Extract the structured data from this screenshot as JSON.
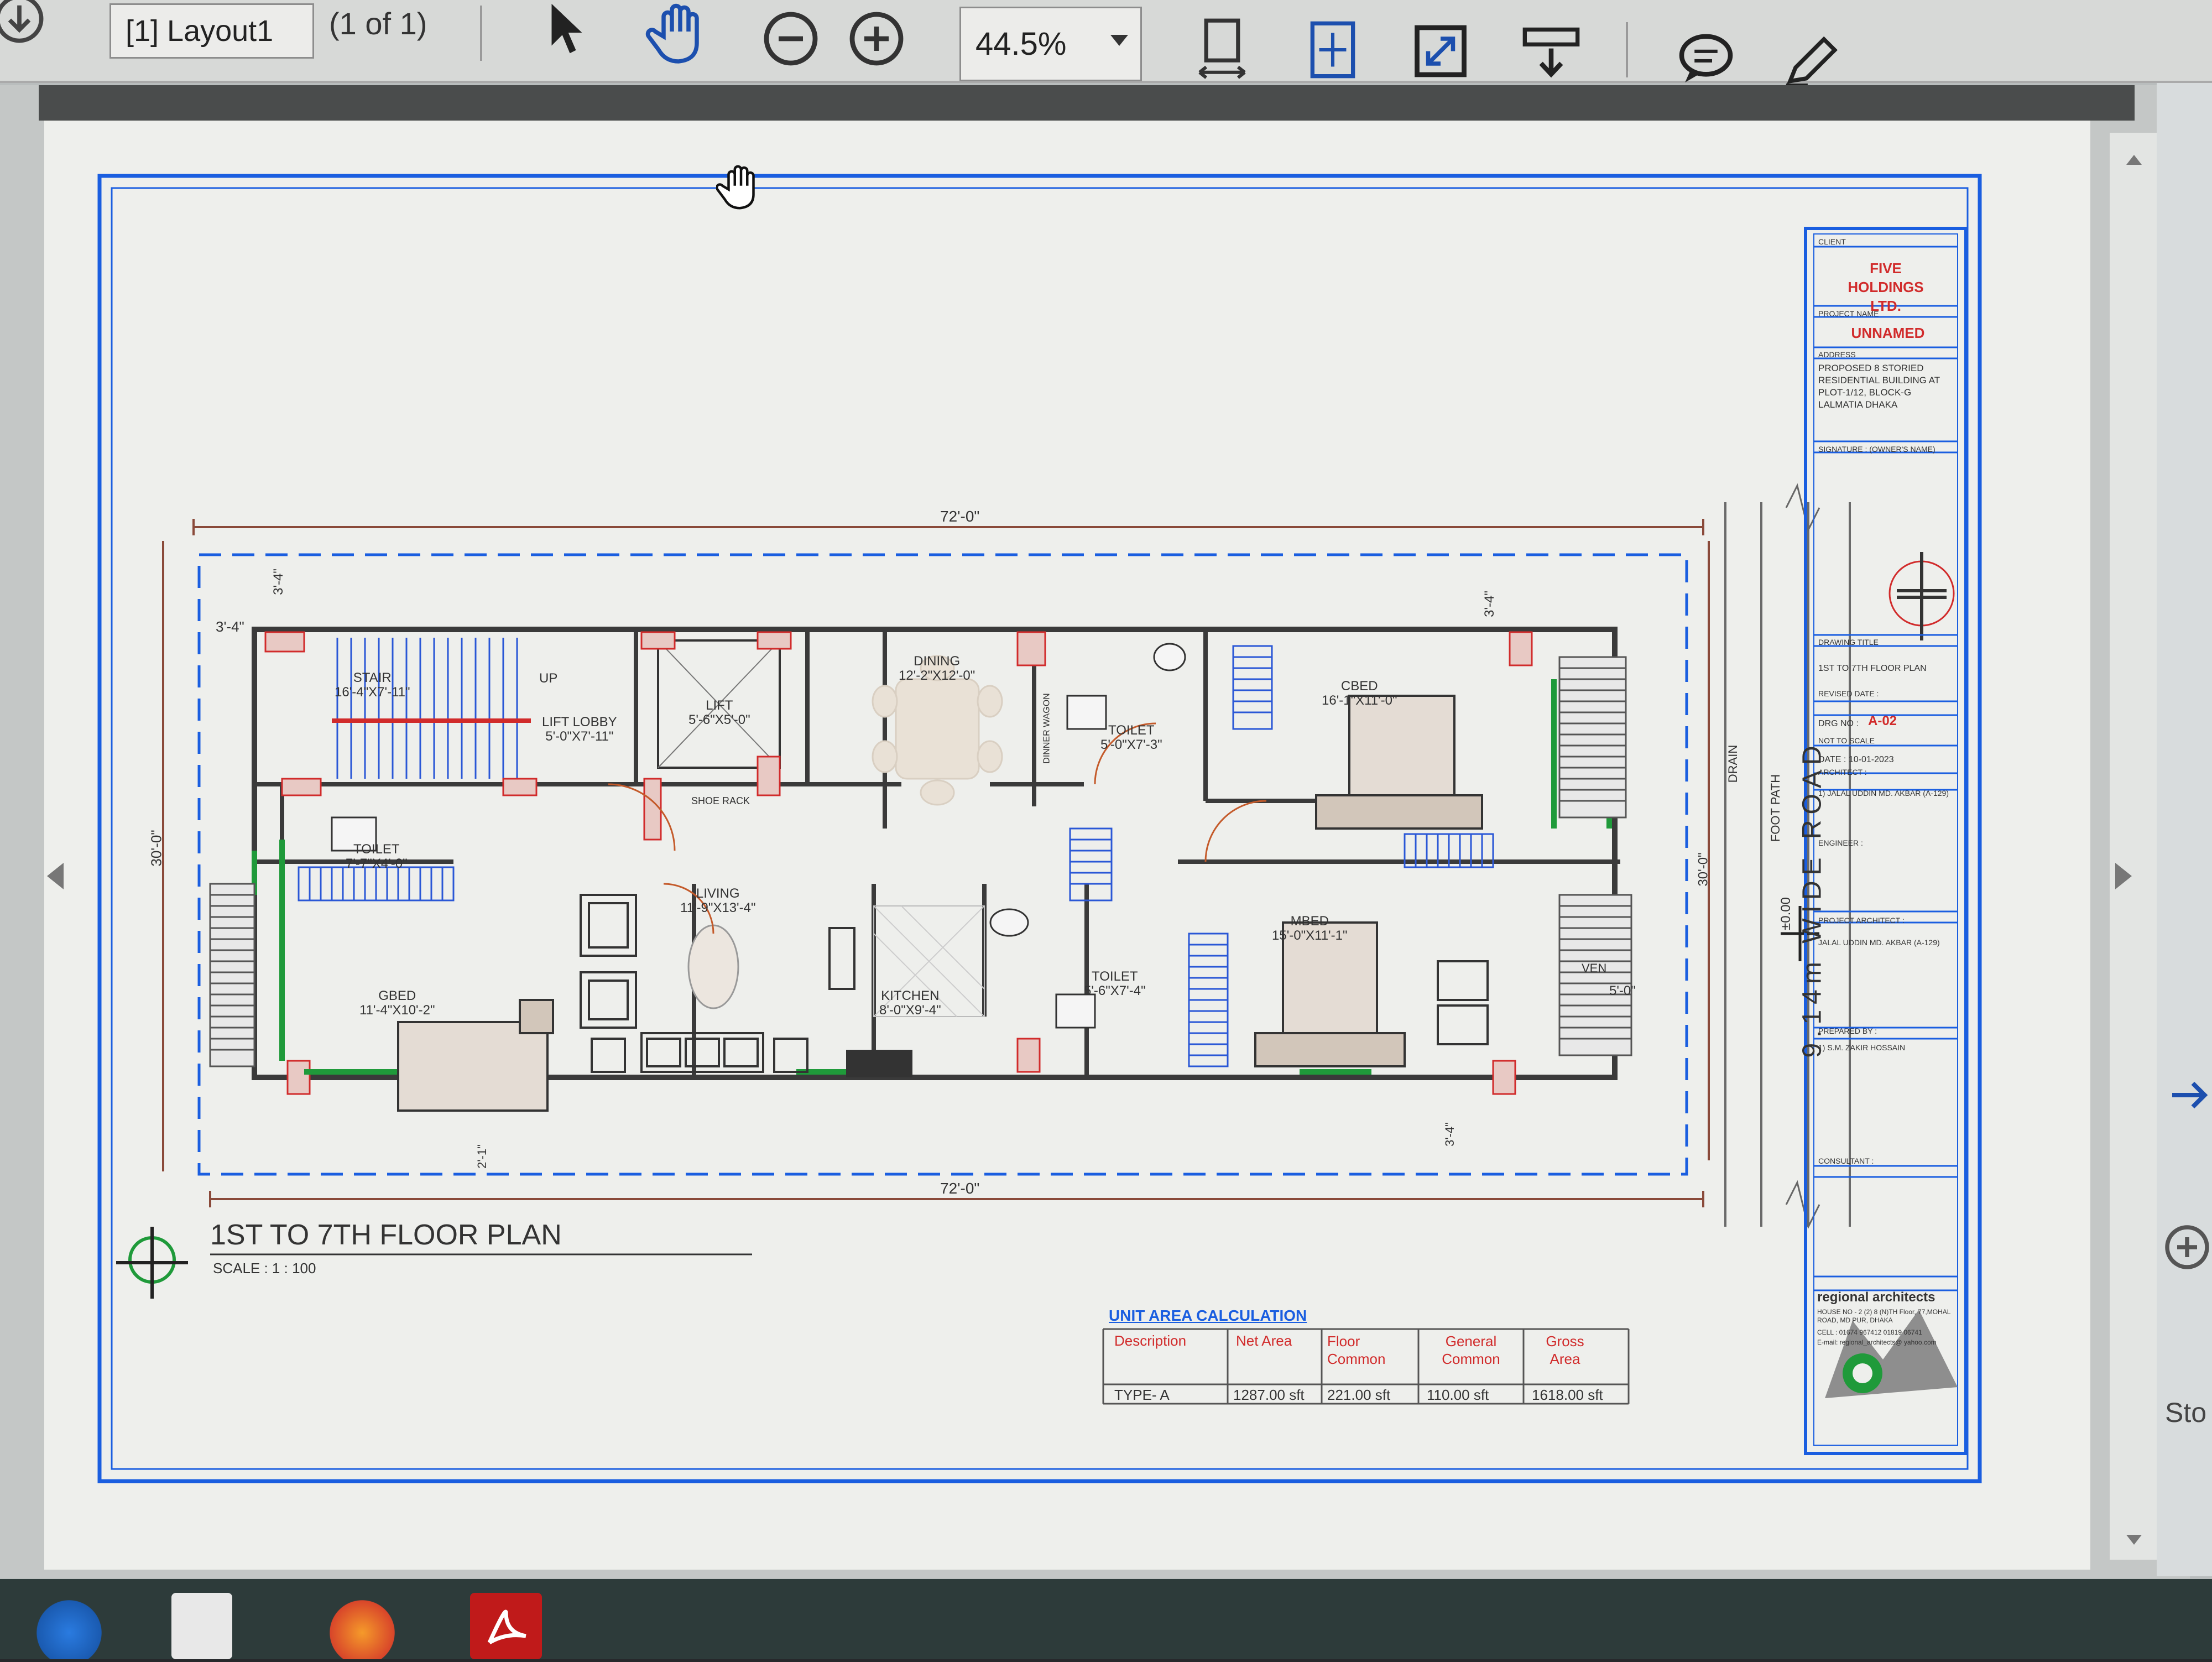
{
  "toolbar": {
    "layout_tab": "[1] Layout1",
    "page_count": "(1 of 1)",
    "zoom": "44.5%"
  },
  "drawing": {
    "dim_top": "72'-0\"",
    "dim_bottom": "72'-0\"",
    "dim_left": "30'-0\"",
    "dim_right": "30'-0\"",
    "dim_tl_h": "3'-4\"",
    "dim_tl_v": "3'-4\"",
    "dim_tr_v": "3'-4\"",
    "dim_right_setback": "5'-0\"",
    "dim_br_v": "3'-4\"",
    "dim_bl_v": "2'-1\"",
    "road": "9.14m WIDE ROAD",
    "drain": "DRAIN",
    "footpath": "FOOT PATH",
    "level": "±0.00",
    "rooms": {
      "stair": [
        "STAIR",
        "16'-4\"X7'-11\""
      ],
      "up": "UP",
      "lift_lobby": [
        "LIFT LOBBY",
        "5'-0\"X7'-11\""
      ],
      "lift": [
        "LIFT",
        "5'-6\"X5'-0\""
      ],
      "shoe_rack": "SHOE RACK",
      "dining": [
        "DINING",
        "12'-2\"X12'-0\""
      ],
      "dinner_wagon": "DINNER WAGON",
      "toilet_1": [
        "TOILET",
        "5'-0\"X7'-3\""
      ],
      "cbed": [
        "CBED",
        "16'-1\"X11'-0\""
      ],
      "toilet_2": [
        "TOILET",
        "7'-7\"X4'-0\""
      ],
      "living": [
        "LIVING",
        "11'-9\"X13'-4\""
      ],
      "gbed": [
        "GBED",
        "11'-4\"X10'-2\""
      ],
      "kitchen": [
        "KITCHEN",
        "8'-0\"X9'-4\""
      ],
      "toilet_3": [
        "TOILET",
        "5'-6\"X7'-4\""
      ],
      "mbed": [
        "MBED",
        "15'-0\"X11'-1\""
      ],
      "ven": "VEN"
    },
    "plan_title": "1ST TO 7TH FLOOR PLAN",
    "plan_scale": "SCALE : 1 : 100"
  },
  "area_table": {
    "title": "UNIT AREA CALCULATION",
    "headers": [
      "Description",
      "Net Area",
      "Floor Common",
      "General Common",
      "Gross Area"
    ],
    "row": [
      "TYPE- A",
      "1287.00 sft",
      "221.00 sft",
      "110.00 sft",
      "1618.00 sft"
    ]
  },
  "title_block": {
    "client_label": "CLIENT",
    "client": "FIVE HOLDINGS LTD.",
    "project_label": "PROJECT NAME",
    "project": "UNNAMED",
    "address_label": "ADDRESS",
    "address": "PROPOSED 8 STORIED RESIDENTIAL BUILDING AT PLOT-1/12, BLOCK-G LALMATIA DHAKA",
    "signature_label": "SIGNATURE : (OWNER'S NAME)",
    "drawing_title_label": "DRAWING TITLE",
    "drawing_title": "1ST TO 7TH FLOOR PLAN",
    "revised_date": "REVISED DATE :",
    "drg_no_label": "DRG NO :",
    "drg_no": "A-02",
    "scale": "NOT TO SCALE",
    "date": "DATE : 10-01-2023",
    "architect_label": "ARCHITECT :",
    "architect": "1) JALAL UDDIN MD. AKBAR (A-129)",
    "engineer_label": "ENGINEER :",
    "project_architect_label": "PROJECT ARCHITECT :",
    "project_architect": "JALAL UDDIN MD. AKBAR (A-129)",
    "prepared_label": "PREPARED BY :",
    "prepared": "1) S.M. ZAKIR HOSSAIN",
    "consultant_label": "CONSULTANT :",
    "firm": "regional architects",
    "firm_address": "HOUSE NO - 2 (2) 8 (N)TH Floor, 77,MOHAL ROAD, MD PUR, DHAKA",
    "firm_cell": "CELL : 01674 967412 01819 06741",
    "firm_email": "E-mail: regional_architects@ yahoo.com"
  },
  "side_text": "Sto",
  "colors": {
    "frame_blue": "#1a5ee0",
    "wall": "#3a3a3a",
    "accent_red": "#d12b2b",
    "accent_green": "#1f9a3a",
    "dim_line": "#8a4a3a"
  }
}
